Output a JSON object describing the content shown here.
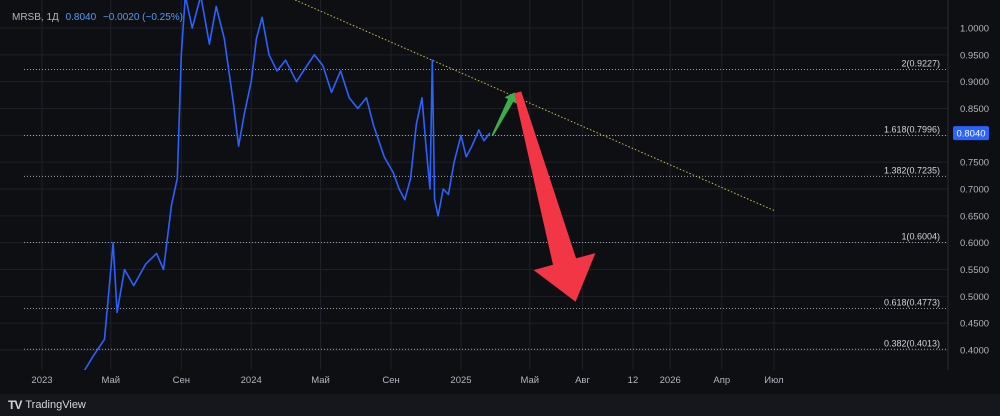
{
  "header": {
    "symbol": "MRSB, 1Д",
    "last": "0.8040",
    "change": "−0.0020 (−0.25%)"
  },
  "footer": {
    "brand": "TradingView",
    "brand_icon": "tradingview-logo-icon"
  },
  "colors": {
    "background": "#0e0f13",
    "grid": "#1f2128",
    "price": "#2962ff",
    "fib": "#9aa0aa",
    "trend": "#c9c24a",
    "up_arrow": "#3dad4b",
    "down_arrow": "#f23645",
    "badge": "#2962ff"
  },
  "chart_data": {
    "type": "line",
    "symbol": "MRSB",
    "interval": "1Д",
    "x_ticks": [
      "2023",
      "Май",
      "Сен",
      "2024",
      "Май",
      "Сен",
      "2025",
      "Май",
      "Авг",
      "12",
      "2026",
      "Апр",
      "Июл"
    ],
    "x_range": [
      "2023-01-01",
      "2026-09-01"
    ],
    "y_ticks": [
      "1.0000",
      "0.9500",
      "0.9000",
      "0.8500",
      "0.8000",
      "0.7500",
      "0.7000",
      "0.6500",
      "0.6000",
      "0.5500",
      "0.5000",
      "0.4500",
      "0.4000"
    ],
    "ylim": [
      0.37,
      1.06
    ],
    "last_price": "0.8040",
    "series": [
      {
        "values": [
          [
            "2023-03-15",
            0.36
          ],
          [
            "2023-04-01",
            0.39
          ],
          [
            "2023-04-20",
            0.42
          ],
          [
            "2023-05-01",
            0.55
          ],
          [
            "2023-05-05",
            0.6
          ],
          [
            "2023-05-12",
            0.47
          ],
          [
            "2023-05-25",
            0.55
          ],
          [
            "2023-06-10",
            0.52
          ],
          [
            "2023-07-01",
            0.56
          ],
          [
            "2023-07-20",
            0.58
          ],
          [
            "2023-08-01",
            0.55
          ],
          [
            "2023-08-15",
            0.67
          ],
          [
            "2023-08-25",
            0.72
          ],
          [
            "2023-09-01",
            0.95
          ],
          [
            "2023-09-08",
            1.06
          ],
          [
            "2023-09-20",
            1.0
          ],
          [
            "2023-10-05",
            1.06
          ],
          [
            "2023-10-20",
            0.97
          ],
          [
            "2023-11-01",
            1.04
          ],
          [
            "2023-11-15",
            0.98
          ],
          [
            "2023-12-01",
            0.86
          ],
          [
            "2023-12-10",
            0.78
          ],
          [
            "2023-12-20",
            0.84
          ],
          [
            "2024-01-01",
            0.9
          ],
          [
            "2024-01-10",
            0.98
          ],
          [
            "2024-01-20",
            1.02
          ],
          [
            "2024-02-01",
            0.95
          ],
          [
            "2024-02-15",
            0.92
          ],
          [
            "2024-03-01",
            0.94
          ],
          [
            "2024-03-20",
            0.9
          ],
          [
            "2024-04-01",
            0.92
          ],
          [
            "2024-04-20",
            0.95
          ],
          [
            "2024-05-05",
            0.93
          ],
          [
            "2024-05-20",
            0.88
          ],
          [
            "2024-06-05",
            0.92
          ],
          [
            "2024-06-20",
            0.87
          ],
          [
            "2024-07-05",
            0.85
          ],
          [
            "2024-07-20",
            0.87
          ],
          [
            "2024-08-01",
            0.82
          ],
          [
            "2024-08-20",
            0.76
          ],
          [
            "2024-09-05",
            0.73
          ],
          [
            "2024-09-15",
            0.7
          ],
          [
            "2024-09-25",
            0.68
          ],
          [
            "2024-10-05",
            0.72
          ],
          [
            "2024-10-15",
            0.82
          ],
          [
            "2024-10-25",
            0.87
          ],
          [
            "2024-11-01",
            0.78
          ],
          [
            "2024-11-08",
            0.7
          ],
          [
            "2024-11-12",
            0.94
          ],
          [
            "2024-11-16",
            0.68
          ],
          [
            "2024-11-22",
            0.65
          ],
          [
            "2024-12-01",
            0.7
          ],
          [
            "2024-12-10",
            0.69
          ],
          [
            "2024-12-20",
            0.75
          ],
          [
            "2025-01-01",
            0.8
          ],
          [
            "2025-01-10",
            0.76
          ],
          [
            "2025-01-20",
            0.78
          ],
          [
            "2025-02-01",
            0.81
          ],
          [
            "2025-02-10",
            0.79
          ],
          [
            "2025-02-20",
            0.804
          ]
        ]
      }
    ],
    "fib_levels": [
      {
        "label": "2(0.9227)",
        "value": 0.9227
      },
      {
        "label": "1.618(0.7996)",
        "value": 0.7996
      },
      {
        "label": "1.382(0.7235)",
        "value": 0.7235
      },
      {
        "label": "1(0.6004)",
        "value": 0.6004
      },
      {
        "label": "0.618(0.4773)",
        "value": 0.4773
      },
      {
        "label": "0.382(0.4013)",
        "value": 0.4013
      }
    ],
    "trendline": {
      "from": [
        "2024-03-01",
        1.06
      ],
      "to": [
        "2026-07-01",
        0.66
      ],
      "style": "dotted"
    },
    "annotations": [
      {
        "type": "arrow",
        "color": "green",
        "from": [
          "2025-02-25",
          0.8
        ],
        "to": [
          "2025-04-05",
          0.88
        ]
      },
      {
        "type": "arrow",
        "color": "red",
        "from": [
          "2025-04-10",
          0.88
        ],
        "to": [
          "2025-07-20",
          0.49
        ]
      }
    ],
    "grid": true
  }
}
